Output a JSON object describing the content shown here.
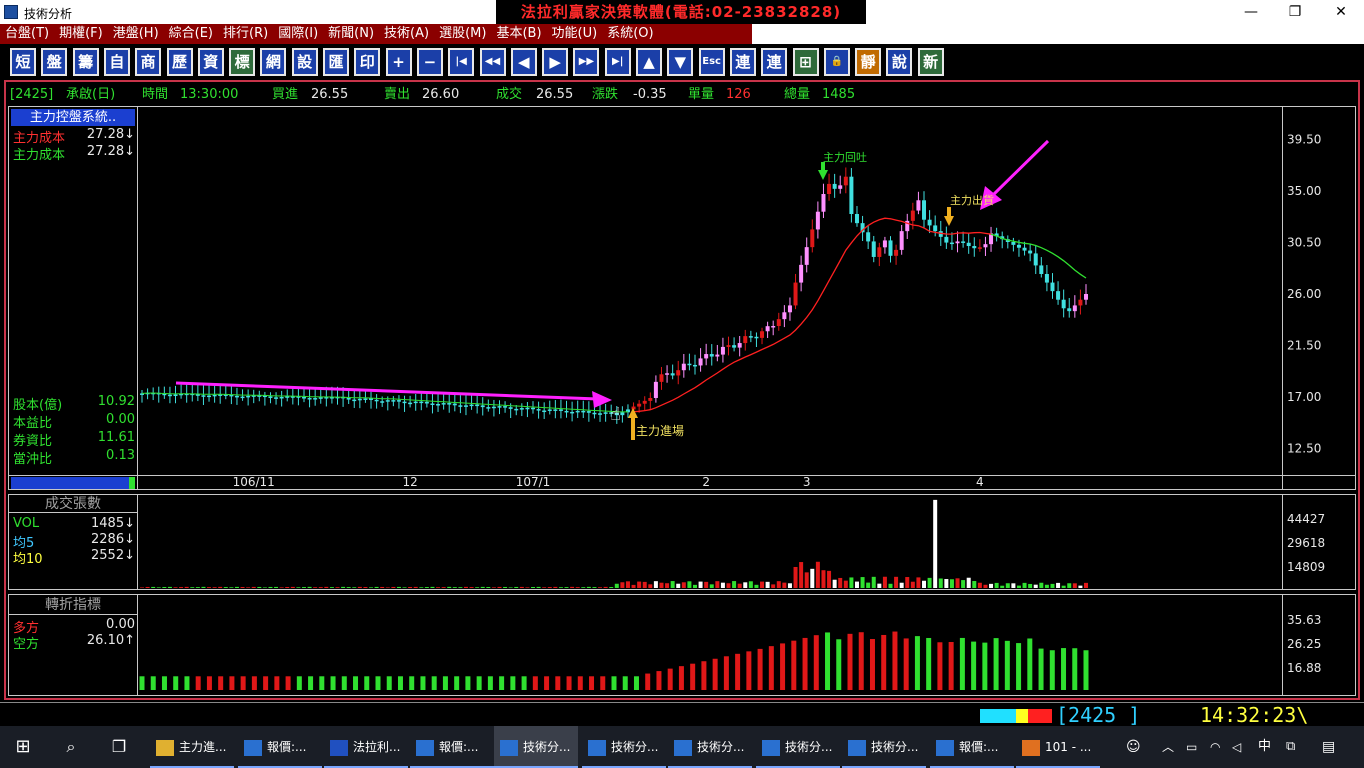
{
  "window": {
    "title": "技術分析",
    "banner": "法拉利贏家決策軟體(電話:02-23832828)",
    "controls": {
      "minimize": "—",
      "restore": "❐",
      "close": "✕"
    }
  },
  "menu": [
    "台盤(T)",
    "期權(F)",
    "港盤(H)",
    "綜合(E)",
    "排行(R)",
    "國際(I)",
    "新聞(N)",
    "技術(A)",
    "選股(M)",
    "基本(B)",
    "功能(U)",
    "系統(O)"
  ],
  "toolbar": [
    {
      "label": "短",
      "icon": "short-term-icon"
    },
    {
      "label": "盤",
      "icon": "board-icon"
    },
    {
      "label": "籌",
      "icon": "chips-icon"
    },
    {
      "label": "自",
      "icon": "self-select-icon"
    },
    {
      "label": "商",
      "icon": "commodity-icon"
    },
    {
      "label": "歷",
      "icon": "history-icon"
    },
    {
      "label": "資",
      "icon": "info-icon"
    },
    {
      "label": "標",
      "icon": "mark-icon"
    },
    {
      "label": "網",
      "icon": "web-icon"
    },
    {
      "label": "設",
      "icon": "settings-icon"
    },
    {
      "label": "匯",
      "icon": "export-icon"
    },
    {
      "label": "印",
      "icon": "print-icon"
    },
    {
      "label": "+",
      "icon": "zoom-in-icon"
    },
    {
      "label": "−",
      "icon": "zoom-out-icon"
    },
    {
      "label": "|◀",
      "icon": "first-icon"
    },
    {
      "label": "◀◀",
      "icon": "fast-back-icon"
    },
    {
      "label": "◀",
      "icon": "back-icon"
    },
    {
      "label": "▶",
      "icon": "forward-icon"
    },
    {
      "label": "▶▶",
      "icon": "fast-forward-icon"
    },
    {
      "label": "▶|",
      "icon": "last-icon"
    },
    {
      "label": "▲",
      "icon": "up-icon"
    },
    {
      "label": "▼",
      "icon": "down-icon"
    },
    {
      "label": "Esc",
      "icon": "escape-icon"
    },
    {
      "label": "連",
      "icon": "link-icon"
    },
    {
      "label": "連",
      "icon": "link2-icon"
    },
    {
      "label": "⊞",
      "icon": "window-icon"
    },
    {
      "label": "🔒",
      "icon": "lock-icon"
    },
    {
      "label": "靜",
      "icon": "static-icon"
    },
    {
      "label": "說",
      "icon": "help-icon"
    },
    {
      "label": "新",
      "icon": "new-icon"
    }
  ],
  "quote": {
    "code": "[2425]",
    "name": "承啟(日)",
    "time_label": "時間",
    "time": "13:30:00",
    "bid_label": "買進",
    "bid": "26.55",
    "ask_label": "賣出",
    "ask": "26.60",
    "deal_label": "成交",
    "deal": "26.55",
    "change_label": "漲跌",
    "change": "-0.35",
    "unit_vol_label": "單量",
    "unit_vol": "126",
    "total_vol_label": "總量",
    "total_vol": "1485"
  },
  "side_panel": {
    "header": "主力控盤系統..",
    "rows": [
      {
        "label": "主力成本",
        "value": "27.28↓",
        "color": "#ff3030"
      },
      {
        "label": "主力成本",
        "value": "27.28↓",
        "color": "#30e030"
      }
    ],
    "stats": [
      {
        "label": "股本(億)",
        "value": "10.92"
      },
      {
        "label": "本益比",
        "value": "0.00"
      },
      {
        "label": "券資比",
        "value": "11.61"
      },
      {
        "label": "當沖比",
        "value": "0.13"
      }
    ]
  },
  "volume_panel": {
    "header": "成交張數",
    "rows": [
      {
        "label": "VOL",
        "value": "1485↓",
        "color": "#30e030"
      },
      {
        "label": "均5",
        "value": "2286↓",
        "color": "#40c8ff"
      },
      {
        "label": "均10",
        "value": "2552↓",
        "color": "#ffff40"
      }
    ]
  },
  "turn_panel": {
    "header": "轉折指標",
    "rows": [
      {
        "label": "多方",
        "value": "0.00",
        "color": "#ff3030"
      },
      {
        "label": "空方",
        "value": "26.10↑",
        "color": "#30e030"
      }
    ]
  },
  "annotations": {
    "main_out": "主力出貨",
    "main_back": "主力回吐",
    "main_in": "主力進場"
  },
  "chart_data": {
    "type": "candlestick",
    "price_axis": [
      "39.50",
      "35.00",
      "30.50",
      "26.00",
      "21.50",
      "17.00",
      "12.50"
    ],
    "price_range": [
      10.6,
      42.1
    ],
    "date_ticks": [
      {
        "label": "106/11",
        "index": 20
      },
      {
        "label": "12",
        "index": 48
      },
      {
        "label": "107/1",
        "index": 70
      },
      {
        "label": "2",
        "index": 101
      },
      {
        "label": "3",
        "index": 119
      },
      {
        "label": "4",
        "index": 150
      }
    ],
    "volume_axis": [
      "44427",
      "29618",
      "14809"
    ],
    "volume_max": 48000,
    "turn_axis": [
      "35.63",
      "26.25",
      "16.88"
    ],
    "turn_range": [
      12.0,
      39.0
    ],
    "colors": {
      "up": "#e01818",
      "up_hi": "#ff90ff",
      "down": "#40e0e0",
      "ma": "#ff2020",
      "ma2": "#30e030",
      "arrow": "#ff20ff",
      "vol_up": "#e01818",
      "vol_down": "#30e030",
      "vol_big": "#ffffff"
    }
  },
  "status": {
    "code_display": "[2425 ]",
    "clock": "14:32:23\\"
  },
  "taskbar": {
    "items": [
      "主力進...",
      "報價:...",
      "法拉利...",
      "報價:...",
      "技術分...",
      "技術分...",
      "技術分...",
      "技術分...",
      "技術分...",
      "報價:...",
      "101 - ..."
    ],
    "tray_lang": "中"
  }
}
